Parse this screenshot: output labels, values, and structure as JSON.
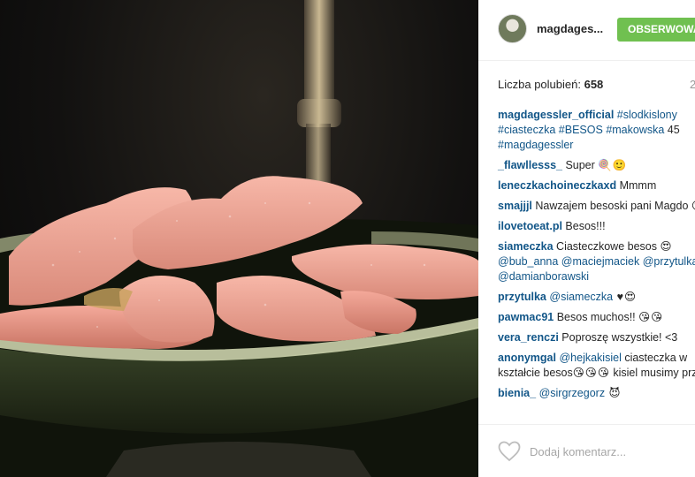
{
  "header": {
    "username": "magdages...",
    "follow_label": "OBSERWOWA"
  },
  "post": {
    "likes_label": "Liczba polubień:",
    "likes_count": "658",
    "time_ago": "2"
  },
  "caption": {
    "username": "magdagessler_official",
    "hashtags": [
      "#slodkislony",
      "#ciasteczka",
      "#BESOS",
      "#makowska"
    ],
    "tail_text": " 45 ",
    "hashtag_last": "#magdagessler"
  },
  "comments": [
    {
      "user": "_flawllesss_",
      "text": " Super ",
      "emoji": "🍭🙂"
    },
    {
      "user": "leneczkachoineczkaxd",
      "text": " Mmmm"
    },
    {
      "user": "smajjjl",
      "text": " Nawzajem besoski pani Magdo ",
      "emoji": "😘😘"
    },
    {
      "user": "ilovetoeat.pl",
      "text": " Besos!!!"
    },
    {
      "user": "siameczka",
      "text": " Ciasteczkowe besos 😍 ",
      "mentions": [
        "@bub_anna",
        "@maciejmaciek",
        "@przytulka",
        "@damianborawski"
      ]
    },
    {
      "user": "przytulka",
      "mention": "@siameczka",
      "emoji": " ♥😍"
    },
    {
      "user": "pawmac91",
      "text": " Besos muchos!! ",
      "emoji": "😘😘"
    },
    {
      "user": "vera_renczi",
      "text": " Poproszę wszystkie! <3"
    },
    {
      "user": "anonymgal",
      "mention": "@hejkakisiel",
      "text": " ciasteczka w kształcie besos",
      "emoji": "😘😘😘",
      "text2": " kisiel musimy przepis"
    },
    {
      "user": "bienia_",
      "mention": "@sirgrzegorz",
      "emoji": " 😈"
    }
  ],
  "footer": {
    "add_comment_placeholder": "Dodaj komentarz..."
  },
  "icons": {
    "heart": "heart-outline-icon"
  }
}
